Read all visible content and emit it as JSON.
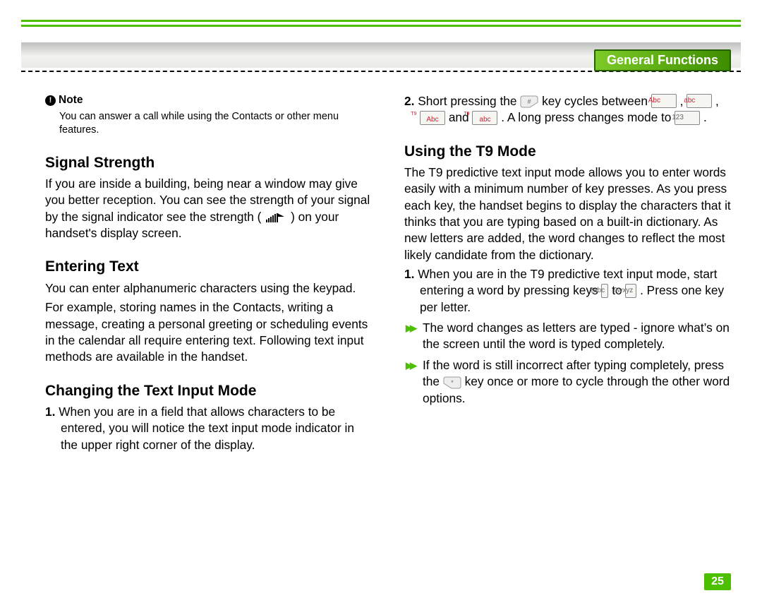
{
  "section_tab": "General Functions",
  "note": {
    "label": "Note",
    "body": "You can answer a call while using the Contacts or other menu features."
  },
  "left": {
    "h_signal": "Signal Strength",
    "signal_p1a": "If you are inside a building, being near a window may give you better reception. You can see the strength of your signal by the signal indicator see the strength ( ",
    "signal_p1b": " ) on your handset's display screen.",
    "h_entering": "Entering Text",
    "entering_p1": "You can enter alphanumeric characters using the keypad.",
    "entering_p2": "For example, storing names in the Contacts, writing a message, creating a personal greeting or scheduling events in the calendar all require entering text. Following text input methods are available in the handset.",
    "h_changing": "Changing the Text Input Mode",
    "changing_li1": "When you are in a field that allows characters to be entered, you will notice the text input mode indicator in the upper right corner of the display."
  },
  "right": {
    "li2_a": "Short pressing the ",
    "li2_b": " key cycles between ",
    "li2_c": " , ",
    "li2_d": " , ",
    "li2_e": " and ",
    "li2_f": " . A long press changes mode to ",
    "li2_g": " .",
    "badge_Abc": "Abc",
    "badge_abc": "abc",
    "badge_T9Abc_top": "T9",
    "badge_T9Abc_bot": "Abc",
    "badge_T9abc_top": "T9",
    "badge_T9abc_bot": "abc",
    "badge_123": "123",
    "h_t9": "Using the T9 Mode",
    "t9_p1": "The T9 predictive text input mode allows you to enter words easily with a minimum number of key presses. As you press each key, the handset begins to display the characters that it thinks that you are typing based on a built-in dictionary. As new letters are added, the word changes to reflect the most likely candidate from the dictionary.",
    "t9_li1_a": "When you are in the T9 predictive text input mode, start entering a word by pressing keys ",
    "t9_li1_b": " to ",
    "t9_li1_c": " . Press one key per letter.",
    "badge_key2": "2abc",
    "badge_key9": "9wxyz",
    "t9_b1": "The word changes as letters are typed - ignore what’s on the screen until the word is typed completely.",
    "t9_b2_a": "If the word is still incorrect after typing completely, press the ",
    "t9_b2_b": " key once or more to cycle through the other word options."
  },
  "numbers": {
    "one": "1",
    "two": "2"
  },
  "page_number": "25"
}
